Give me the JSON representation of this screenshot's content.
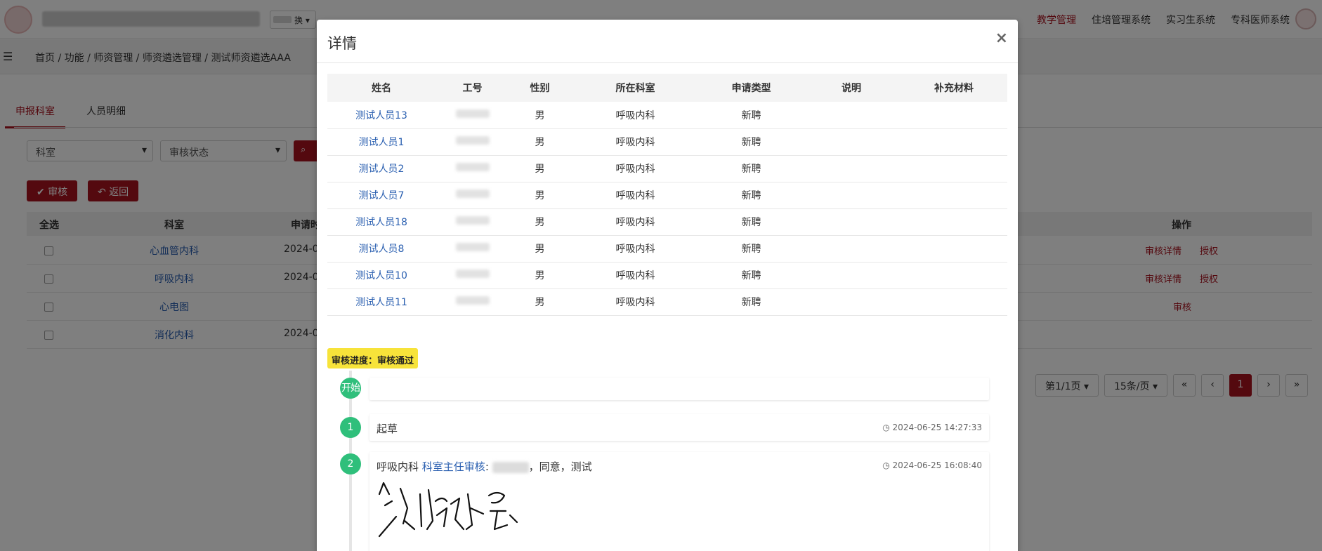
{
  "header": {
    "switch_label": "换",
    "nav_items": [
      "教学管理",
      "住培管理系统",
      "实习生系统",
      "专科医师系统"
    ],
    "active_nav": "教学管理"
  },
  "breadcrumb": "首页 / 功能 / 师资管理 / 师资遴选管理 / 测试师资遴选AAA",
  "tabs": [
    "申报科室",
    "人员明细"
  ],
  "filters": {
    "dept_placeholder": "科室",
    "status_placeholder": "审核状态"
  },
  "actions": {
    "audit": "审核",
    "back": "返回"
  },
  "bg_table": {
    "headers": {
      "select_all": "全选",
      "dept": "科室",
      "date": "申请时",
      "ops": "操作"
    },
    "rows": [
      {
        "dept": "心血管内科",
        "date": "2024-0",
        "op1": "审核详情",
        "op2": "授权"
      },
      {
        "dept": "呼吸内科",
        "date": "2024-0",
        "op1": "审核详情",
        "op2": "授权"
      },
      {
        "dept": "心电图",
        "date": "",
        "op1": "审核",
        "op2": ""
      },
      {
        "dept": "消化内科",
        "date": "2024-0",
        "op1": "",
        "op2": ""
      }
    ]
  },
  "pagination": {
    "page_info": "第1/1页",
    "per_page": "15条/页",
    "first": "«",
    "prev": "‹",
    "current": "1",
    "next": "›",
    "last": "»"
  },
  "modal": {
    "title": "详情",
    "close": "×",
    "columns": [
      "姓名",
      "工号",
      "性别",
      "所在科室",
      "申请类型",
      "说明",
      "补充材料"
    ],
    "rows": [
      {
        "name": "测试人员13",
        "gender": "男",
        "dept": "呼吸内科",
        "type": "新聘"
      },
      {
        "name": "测试人员1",
        "gender": "男",
        "dept": "呼吸内科",
        "type": "新聘"
      },
      {
        "name": "测试人员2",
        "gender": "男",
        "dept": "呼吸内科",
        "type": "新聘"
      },
      {
        "name": "测试人员7",
        "gender": "男",
        "dept": "呼吸内科",
        "type": "新聘"
      },
      {
        "name": "测试人员18",
        "gender": "男",
        "dept": "呼吸内科",
        "type": "新聘"
      },
      {
        "name": "测试人员8",
        "gender": "男",
        "dept": "呼吸内科",
        "type": "新聘"
      },
      {
        "name": "测试人员10",
        "gender": "男",
        "dept": "呼吸内科",
        "type": "新聘"
      },
      {
        "name": "测试人员11",
        "gender": "男",
        "dept": "呼吸内科",
        "type": "新聘"
      }
    ],
    "progress_label": "审核进度：审核通过",
    "timeline": {
      "start_label": "开始",
      "step1": {
        "num": "1",
        "text": "起草",
        "time": "2024-06-25 14:27:33"
      },
      "step2": {
        "num": "2",
        "dept": "呼吸内科",
        "role": "科室主任审核",
        "colon": ":",
        "comment": "，同意，测试",
        "time": "2024-06-25 16:08:40"
      }
    }
  },
  "colors": {
    "brand": "#a9121f",
    "link": "#2a5fb0",
    "node": "#2fbf7b",
    "badge": "#f7e33a"
  }
}
